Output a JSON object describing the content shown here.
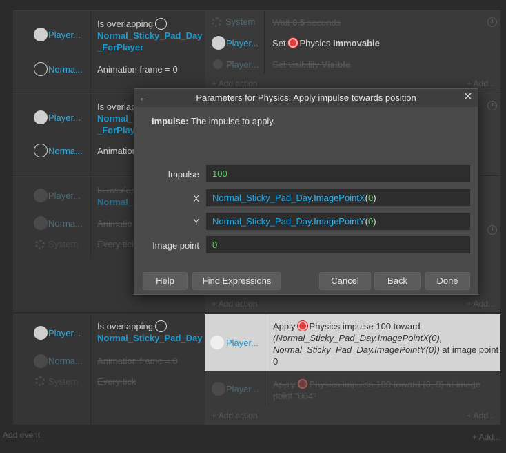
{
  "events": [
    {
      "conditions": [
        {
          "object": "Player...",
          "label": "Is overlapping",
          "target": "Normal_Sticky_Pad_Day_ForPlayer",
          "target_l1": "Normal_Sticky_Pad_Day",
          "target_l2": "_ForPlayer"
        },
        {
          "object": "Norma...",
          "label": "Animation frame = 0"
        }
      ],
      "actions": [
        {
          "object": "System",
          "text": "Wait 0.5 seconds",
          "prefix": "Wait ",
          "value": "0.5",
          "suffix": " seconds"
        },
        {
          "object": "Player...",
          "prefix": "Set",
          "text": "Physics",
          "value": "Immovable"
        },
        {
          "object": "Player...",
          "prefix": "Set visibility",
          "value": "Visible"
        }
      ],
      "add_action": "Add action",
      "add": "Add..."
    },
    {
      "conditions": [
        {
          "object": "Player...",
          "label": "Is overlapp",
          "target_l1": "Normal_",
          "target_l2": "_ForPlay"
        },
        {
          "object": "Norma...",
          "label": "Animation"
        }
      ]
    },
    {
      "conditions": [
        {
          "object": "Player...",
          "label": "Is overlapp",
          "target_l1": "Normal_"
        },
        {
          "object": "Norma...",
          "label": "Animatio"
        },
        {
          "object": "System",
          "label": "Every tick"
        }
      ],
      "add_action": "Add action",
      "add": "Add..."
    },
    {
      "conditions": [
        {
          "object": "Player...",
          "label": "Is overlapping",
          "target": "Normal_Sticky_Pad_Day"
        },
        {
          "object": "Norma...",
          "label": "Animation frame = 0"
        },
        {
          "object": "System",
          "label": "Every tick"
        }
      ],
      "actions": [
        {
          "object": "Player...",
          "prefix": "Apply",
          "behavior": "Physics",
          "line1": "Physics impulse 100 toward",
          "line2": "(Normal_Sticky_Pad_Day.ImagePointX(0),",
          "line3": "Normal_Sticky_Pad_Day.ImagePointY(0))",
          "line3_suffix": " at image point",
          "line4": "0"
        },
        {
          "object": "Player...",
          "line1": "Apply",
          "line1b": "Physics impulse 100 toward (0, 0) at image",
          "line2": "point \"004\""
        }
      ],
      "add_action": "Add action",
      "add": "Add..."
    }
  ],
  "footer": {
    "add_event": "Add event",
    "add": "Add..."
  },
  "modal": {
    "title": "Parameters for Physics: Apply impulse towards position",
    "description_label": "Impulse:",
    "description_text": "The impulse to apply.",
    "fields": [
      {
        "label": "Impulse",
        "value": "100"
      },
      {
        "label": "X",
        "obj": "Normal_Sticky_Pad_Day",
        "fn": "ImagePointX",
        "arg": "0"
      },
      {
        "label": "Y",
        "obj": "Normal_Sticky_Pad_Day",
        "fn": "ImagePointY",
        "arg": "0"
      },
      {
        "label": "Image point",
        "value": "0"
      }
    ],
    "buttons": {
      "help": "Help",
      "find": "Find Expressions",
      "cancel": "Cancel",
      "back": "Back",
      "done": "Done"
    },
    "back_glyph": "←",
    "close_glyph": "✕"
  }
}
